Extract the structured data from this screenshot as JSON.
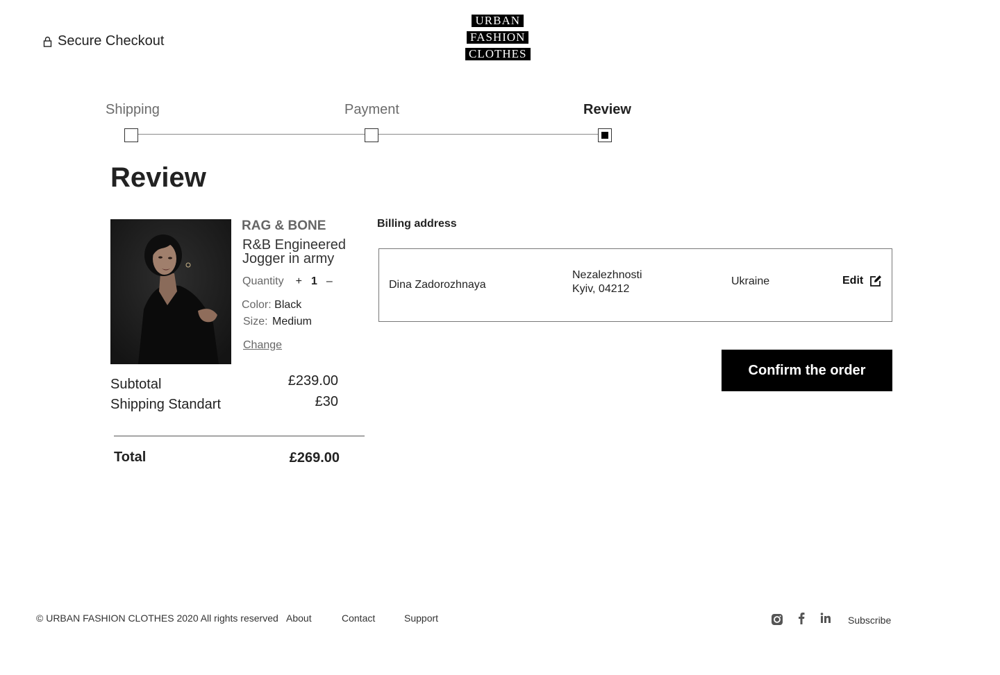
{
  "header": {
    "secure_label": "Secure Checkout",
    "logo_lines": [
      "URBAN",
      "FASHION",
      "CLOTHES"
    ]
  },
  "stepper": {
    "steps": [
      {
        "label": "Shipping",
        "state": "done"
      },
      {
        "label": "Payment",
        "state": "done"
      },
      {
        "label": "Review",
        "state": "active"
      }
    ]
  },
  "page_title": "Review",
  "product": {
    "brand": "RAG & BONE",
    "name": "R&B Engineered Jogger in army",
    "quantity_label": "Quantity",
    "quantity_plus": "+",
    "quantity_value": "1",
    "quantity_minus": "–",
    "color_label": "Color:",
    "color_value": "Black",
    "size_label": "Size:",
    "size_value": "Medium",
    "change_label": "Change"
  },
  "summary": {
    "subtotal_label": "Subtotal",
    "subtotal_value": "£239.00",
    "shipping_label": "Shipping Standart",
    "shipping_value": "£30",
    "total_label": "Total",
    "total_value": "£269.00"
  },
  "billing": {
    "title": "Billing address",
    "name": "Dina Zadorozhnaya",
    "street": "Nezalezhnosti",
    "city": "Kyiv, 04212",
    "country": "Ukraine",
    "edit_label": "Edit"
  },
  "confirm_label": "Confirm the order",
  "footer": {
    "copyright": "© URBAN FASHION CLOTHES  2020  All rights reserved",
    "links": [
      "About",
      "Contact",
      "Support"
    ],
    "social_icons": [
      "instagram-icon",
      "facebook-icon",
      "linkedin-icon"
    ],
    "subscribe_label": "Subscribe"
  },
  "colors": {
    "accent": "#000000",
    "muted_text": "#666666"
  }
}
